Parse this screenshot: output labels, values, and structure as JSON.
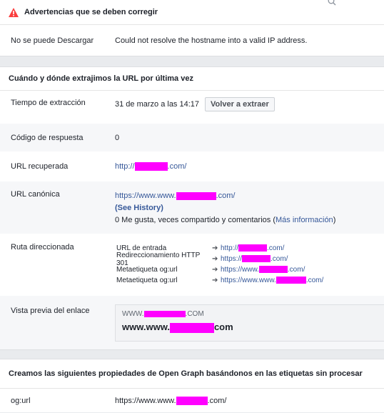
{
  "warnings": {
    "title": "Advertencias que se deben corregir",
    "items": [
      {
        "label": "No se puede Descargar",
        "value": "Could not resolve the hostname into a valid IP address."
      }
    ]
  },
  "scrape": {
    "title": "Cuándo y dónde extrajimos la URL por última vez",
    "time_label": "Tiempo de extracción",
    "time_value": "31 de marzo a las 14:17",
    "rescrape_button": "Volver a extraer",
    "response_label": "Código de respuesta",
    "response_value": "0",
    "fetched_label": "URL recuperada",
    "fetched_prefix": "http://",
    "fetched_suffix": ".com/",
    "canonical_label": "URL canónica",
    "canonical_prefix": "https://www.www.",
    "canonical_suffix": ".com/",
    "see_history": "(See History)",
    "likes_text": "0 Me gusta, veces compartido y comentarios (",
    "more_info": "Más información",
    "likes_close": ")",
    "redirect_label": "Ruta direccionada",
    "redirects": [
      {
        "type": "URL de entrada",
        "prefix": "http://",
        "suffix": ".com/"
      },
      {
        "type": "Redireccionamiento HTTP 301",
        "prefix": "https://",
        "suffix": ".com/"
      },
      {
        "type": "Metaetiqueta og:url",
        "prefix": "https://www.",
        "suffix": ".com/"
      },
      {
        "type": "Metaetiqueta og:url",
        "prefix": "https://www.www.",
        "suffix": ".com/"
      }
    ],
    "preview_label": "Vista previa del enlace",
    "preview_domain_prefix": "WWW.",
    "preview_domain_suffix": ".COM",
    "preview_title_prefix": "www.www.",
    "preview_title_suffix": "com"
  },
  "opengraph": {
    "title": "Creamos las siguientes propiedades de Open Graph basándonos en las etiquetas sin procesar",
    "ogurl_label": "og:url",
    "ogurl_prefix": "https://www.www.",
    "ogurl_suffix": ".com/"
  },
  "colors": {
    "link": "#365899",
    "redaction": "#ff00ff",
    "warning": "#fa3e3e"
  },
  "icons": {
    "warning": "warning-triangle-icon",
    "search": "search-icon",
    "arrow": "arrow-right-icon"
  }
}
